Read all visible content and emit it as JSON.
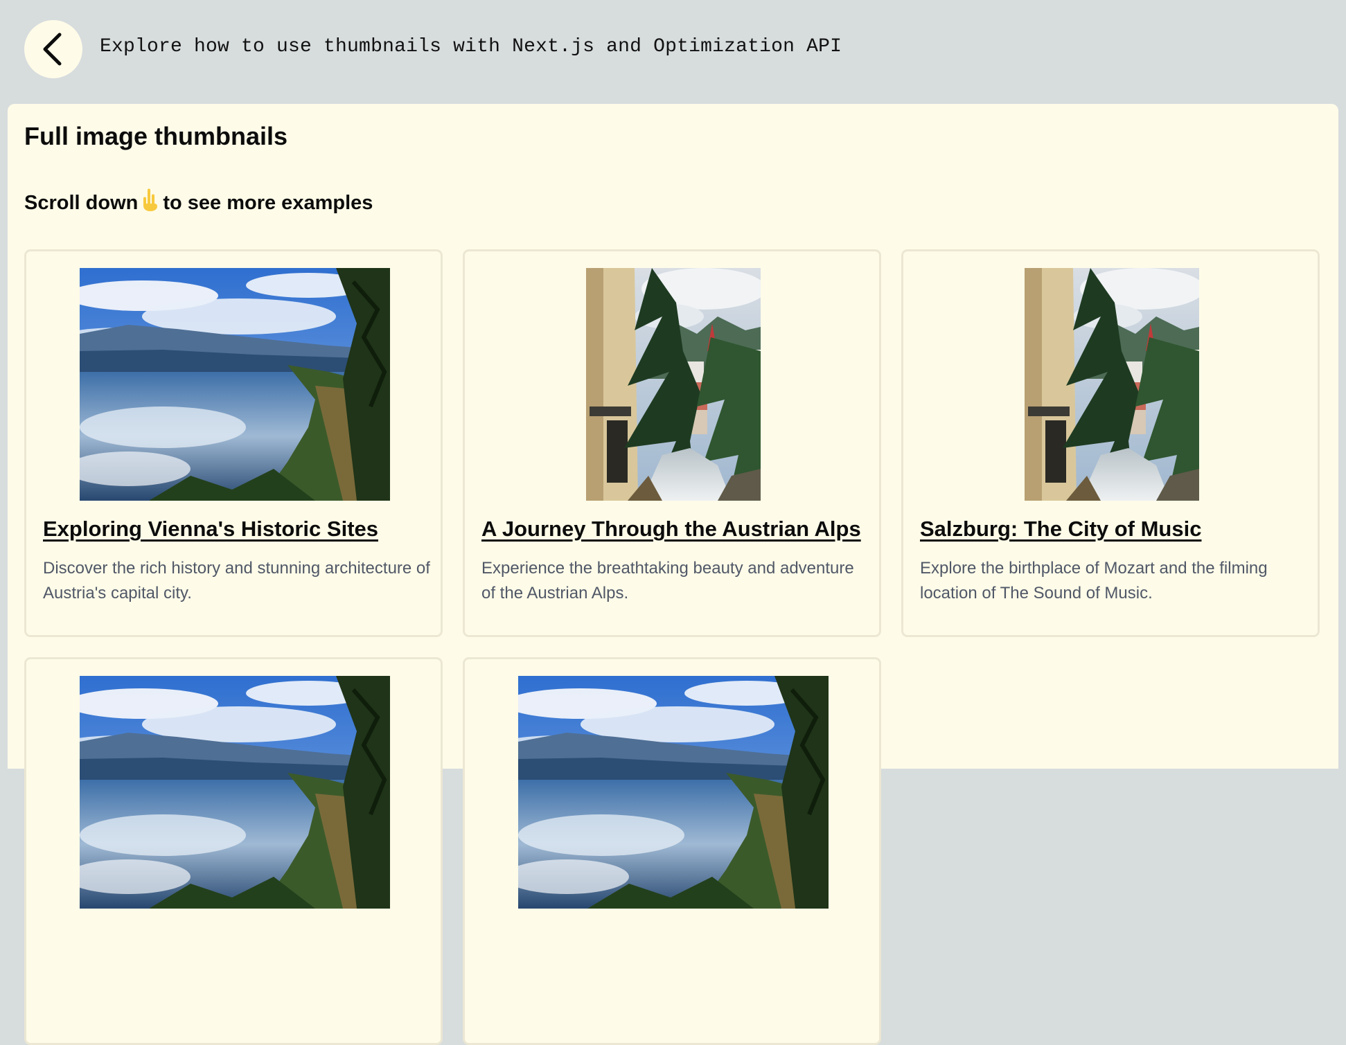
{
  "header": {
    "back_icon": "chevron-left-icon",
    "title": "Explore how to use thumbnails with Next.js and Optimization API"
  },
  "main": {
    "heading": "Full image thumbnails",
    "scroll_hint_before": "Scroll down",
    "scroll_hint_emoji": "👇",
    "scroll_hint_after": "to see more examples"
  },
  "cards": [
    {
      "title": "Exploring Vienna's Historic Sites",
      "description": "Discover the rich history and stunning architecture of Austria's capital city.",
      "image": "lake-landscape"
    },
    {
      "title": "A Journey Through the Austrian Alps",
      "description": "Experience the breathtaking beauty and adventure of the Austrian Alps.",
      "image": "alpine-town-waterfall"
    },
    {
      "title": "Salzburg: The City of Music",
      "description": "Explore the birthplace of Mozart and the filming location of The Sound of Music.",
      "image": "alpine-town-waterfall"
    },
    {
      "title": "",
      "description": "",
      "image": "lake-landscape"
    },
    {
      "title": "",
      "description": "",
      "image": "lake-landscape"
    }
  ],
  "colors": {
    "page_background": "#d7dcdd",
    "panel_background": "#fefbe8",
    "card_border": "#ebe7d3",
    "description_text": "#505867"
  }
}
